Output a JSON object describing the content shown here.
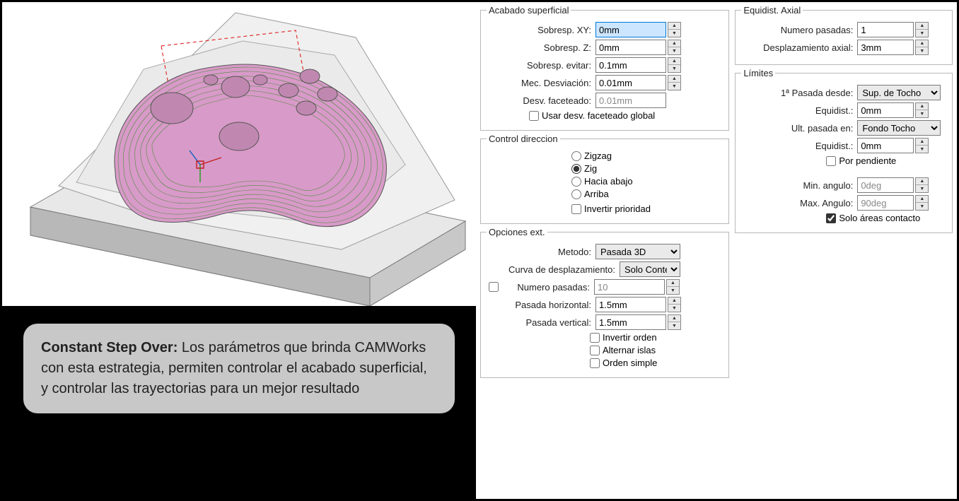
{
  "caption": {
    "title": "Constant Step Over:",
    "body": " Los parámetros que brinda CAMWorks con esta estrategia, permiten controlar el acabado superficial, y controlar las trayectorias para un mejor resultado"
  },
  "acabado": {
    "legend": "Acabado superficial",
    "sobresp_xy_label": "Sobresp. XY:",
    "sobresp_xy_value": "0mm",
    "sobresp_z_label": "Sobresp. Z:",
    "sobresp_z_value": "0mm",
    "sobresp_evitar_label": "Sobresp. evitar:",
    "sobresp_evitar_value": "0.1mm",
    "mec_desv_label": "Mec. Desviación:",
    "mec_desv_value": "0.01mm",
    "desv_fact_label": "Desv. faceteado:",
    "desv_fact_value": "0.01mm",
    "usar_global_label": "Usar desv. faceteado global"
  },
  "direccion": {
    "legend": "Control direccion",
    "zigzag": "Zigzag",
    "zig": "Zig",
    "hacia_abajo": "Hacia abajo",
    "arriba": "Arriba",
    "invertir_prioridad": "Invertir prioridad"
  },
  "opciones": {
    "legend": "Opciones ext.",
    "metodo_label": "Metodo:",
    "metodo_value": "Pasada 3D",
    "curva_label": "Curva de desplazamiento:",
    "curva_value": "Solo Conte",
    "num_pasadas_label": "Numero pasadas:",
    "num_pasadas_value": "10",
    "pasada_h_label": "Pasada horizontal:",
    "pasada_h_value": "1.5mm",
    "pasada_v_label": "Pasada vertical:",
    "pasada_v_value": "1.5mm",
    "invertir_orden": "Invertir orden",
    "alternar_islas": "Alternar islas",
    "orden_simple": "Orden simple"
  },
  "axial": {
    "legend": "Equidist. Axial",
    "num_pasadas_label": "Numero pasadas:",
    "num_pasadas_value": "1",
    "desp_label": "Desplazamiento axial:",
    "desp_value": "3mm"
  },
  "limites": {
    "legend": "Límites",
    "primera_label": "1ª Pasada desde:",
    "primera_value": "Sup. de Tocho",
    "equidist1_label": "Equidist.:",
    "equidist1_value": "0mm",
    "ult_label": "Ult. pasada en:",
    "ult_value": "Fondo Tocho",
    "equidist2_label": "Equidist.:",
    "equidist2_value": "0mm",
    "por_pendiente": "Por pendiente",
    "min_ang_label": "Min. angulo:",
    "min_ang_value": "0deg",
    "max_ang_label": "Max. Angulo:",
    "max_ang_value": "90deg",
    "solo_areas": "Solo áreas contacto"
  }
}
